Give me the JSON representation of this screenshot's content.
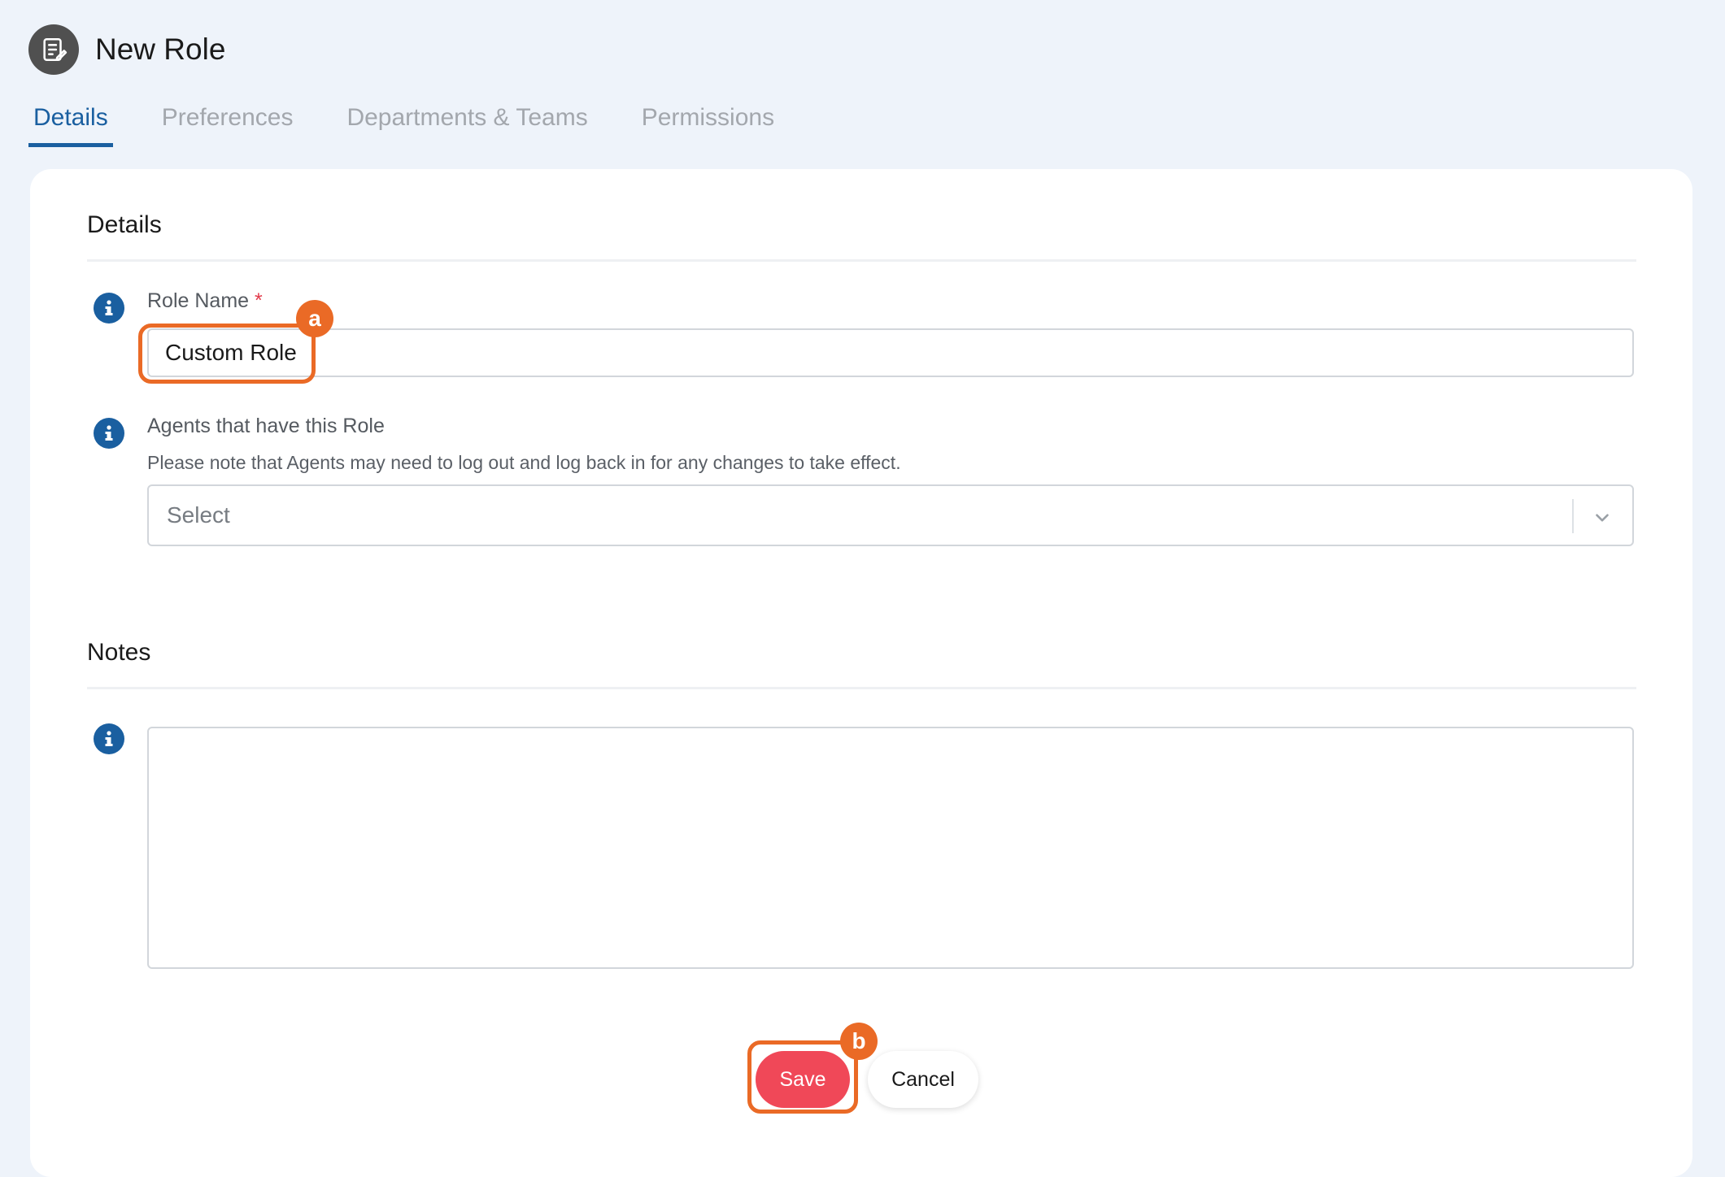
{
  "header": {
    "title": "New Role",
    "icon": "document-edit-icon"
  },
  "tabs": [
    {
      "label": "Details",
      "active": true
    },
    {
      "label": "Preferences",
      "active": false
    },
    {
      "label": "Departments & Teams",
      "active": false
    },
    {
      "label": "Permissions",
      "active": false
    }
  ],
  "details": {
    "section_title": "Details",
    "role_name": {
      "label": "Role Name",
      "required_marker": "*",
      "value": "Custom Role"
    },
    "agents": {
      "label": "Agents that have this Role",
      "hint": "Please note that Agents may need to log out and log back in for any changes to take effect.",
      "select_value": "Select"
    }
  },
  "notes": {
    "section_title": "Notes",
    "value": ""
  },
  "actions": {
    "save_label": "Save",
    "cancel_label": "Cancel"
  },
  "callouts": [
    {
      "label": "a",
      "target": "role-name-input"
    },
    {
      "label": "b",
      "target": "save-button"
    }
  ],
  "colors": {
    "accent": "#1a5fa0",
    "save_button": "#f04858",
    "callout": "#ea6a26",
    "background": "#eef3fa"
  }
}
